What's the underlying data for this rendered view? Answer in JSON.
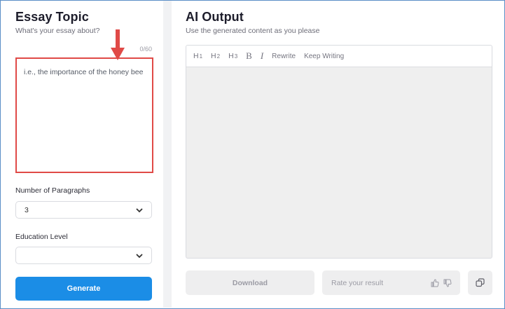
{
  "left": {
    "title": "Essay Topic",
    "subtitle": "What's your essay about?",
    "counter": "0/60",
    "topic_placeholder": "i.e., the importance of the honey bee",
    "paragraphs_label": "Number of Paragraphs",
    "paragraphs_value": "3",
    "education_label": "Education Level",
    "education_value": "",
    "generate_label": "Generate"
  },
  "right": {
    "title": "AI Output",
    "subtitle": "Use the generated content as you please",
    "toolbar": {
      "h1": "H",
      "h1_sub": "1",
      "h2": "H",
      "h2_sub": "2",
      "h3": "H",
      "h3_sub": "3",
      "bold": "B",
      "italic": "I",
      "rewrite": "Rewrite",
      "keep_writing": "Keep Writing"
    },
    "download_label": "Download",
    "rate_label": "Rate your result"
  },
  "colors": {
    "accent": "#1b8de6",
    "highlight": "#e04a47"
  }
}
